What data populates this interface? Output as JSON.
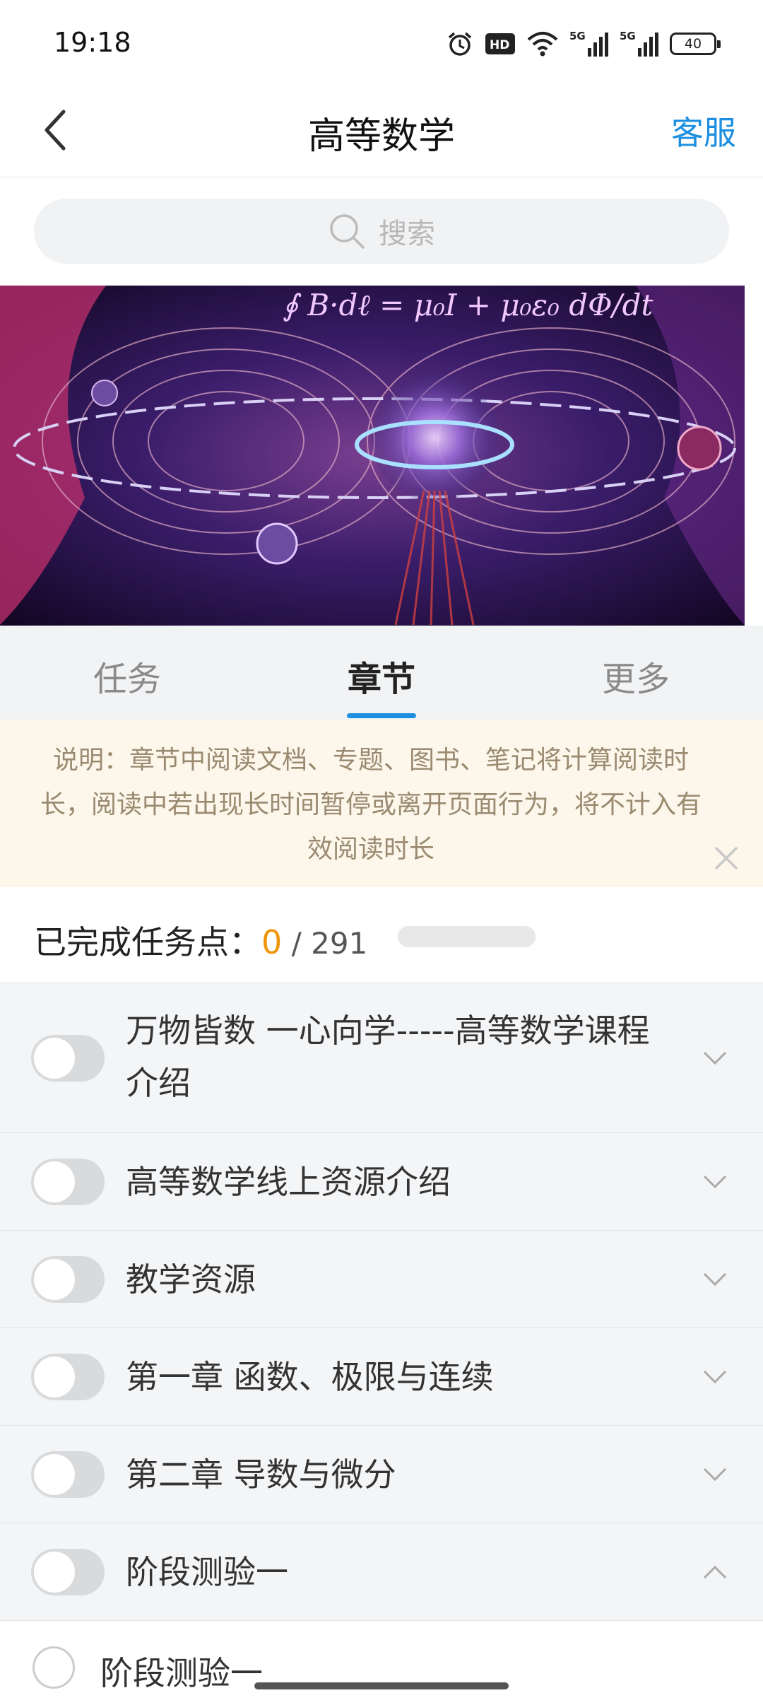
{
  "status_bar": {
    "time": "19:18",
    "network1": "5G",
    "network2": "5G",
    "battery": "40"
  },
  "nav": {
    "title": "高等数学",
    "service_label": "客服"
  },
  "search": {
    "placeholder": "搜索"
  },
  "tabs": [
    {
      "label": "任务",
      "active": false
    },
    {
      "label": "章节",
      "active": true
    },
    {
      "label": "更多",
      "active": false
    }
  ],
  "notice": {
    "text": "说明：章节中阅读文档、专题、图书、笔记将计算阅读时长，阅读中若出现长时间暂停或离开页面行为，将不计入有效阅读时长"
  },
  "progress": {
    "label": "已完成任务点：",
    "completed": "0",
    "separator": " / ",
    "total": "291",
    "fraction": 0
  },
  "chapters": [
    {
      "label": "万物皆数   一心向学-----高等数学课程介绍",
      "expanded": false
    },
    {
      "label": "高等数学线上资源介绍",
      "expanded": false
    },
    {
      "label": "教学资源",
      "expanded": false
    },
    {
      "label": "第一章 函数、极限与连续",
      "expanded": false
    },
    {
      "label": "第二章  导数与微分",
      "expanded": false
    },
    {
      "label": "阶段测验一",
      "expanded": true
    }
  ],
  "sub_items": [
    {
      "label": "阶段测验一"
    }
  ],
  "colors": {
    "accent": "#1c8fe0",
    "completed": "#f0950a",
    "notice_bg": "#fdf7eb"
  }
}
